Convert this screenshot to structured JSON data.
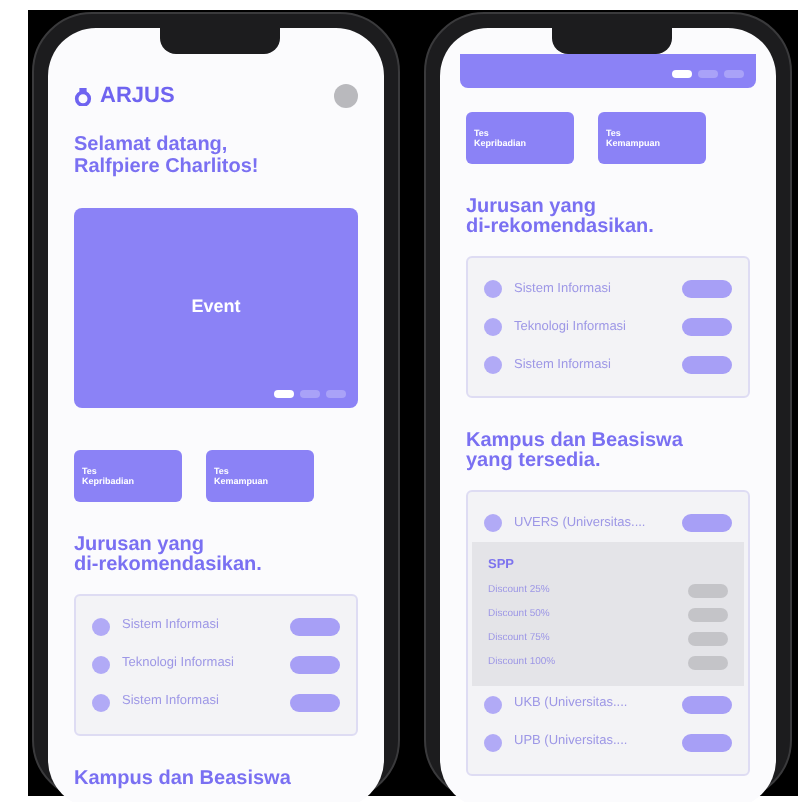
{
  "phones": [
    {
      "sections": [
        {
          "kind": "header",
          "logo": "ARJUS"
        },
        {
          "kind": "greeting",
          "text": "Selamat datang,\nRalfpiere Charlitos!"
        },
        {
          "kind": "banner",
          "label": "Event",
          "slides": [
            {
              "selected": true
            },
            {
              "selected": false
            },
            {
              "selected": false
            }
          ]
        },
        {
          "kind": "tests",
          "items": [
            "Tes\nKepribadian",
            "Tes\nKemampuan"
          ]
        },
        {
          "kind": "list",
          "title": "Jurusan yang\ndi-rekomendasikan.",
          "items": [
            {
              "label": "Sistem Informasi"
            },
            {
              "label": "Teknologi Informasi"
            },
            {
              "label": "Sistem Informasi"
            }
          ]
        },
        {
          "kind": "list",
          "title": "Kampus dan Beasiswa"
        }
      ]
    },
    {
      "sections": [
        {
          "kind": "banner",
          "slides": [
            {
              "selected": true
            },
            {
              "selected": false
            },
            {
              "selected": false
            }
          ]
        },
        {
          "kind": "tests",
          "items": [
            "Tes\nKepribadian",
            "Tes\nKemampuan"
          ]
        },
        {
          "kind": "list",
          "title": "Jurusan yang\ndi-rekomendasikan.",
          "items": [
            {
              "label": "Sistem Informasi"
            },
            {
              "label": "Teknologi Informasi"
            },
            {
              "label": "Sistem Informasi"
            }
          ]
        },
        {
          "kind": "list",
          "title": "Kampus dan Beasiswa\nyang tersedia.",
          "items": [
            {
              "label": "UVERS (Universitas....",
              "expanded": true,
              "detail": {
                "title": "SPP",
                "rows": [
                  "Discount 25%",
                  "Discount 50%",
                  "Discount 75%",
                  "Discount 100%"
                ]
              }
            },
            {
              "label": "UKB (Universitas....",
              "expanded": false
            },
            {
              "label": "UPB (Universitas....",
              "expanded": false
            }
          ]
        }
      ]
    }
  ]
}
